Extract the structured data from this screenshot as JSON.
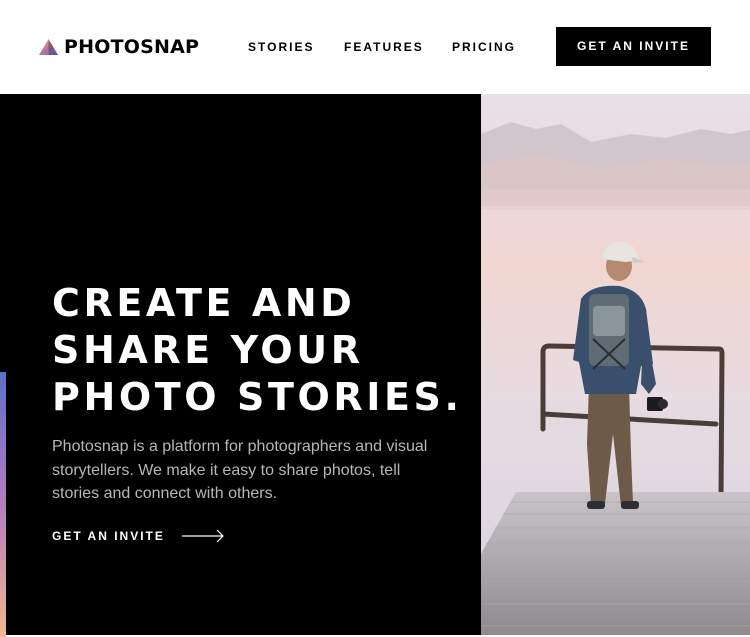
{
  "header": {
    "logo_text": "PHOTOSNAP",
    "nav": [
      {
        "label": "STORIES"
      },
      {
        "label": "FEATURES"
      },
      {
        "label": "PRICING"
      }
    ],
    "cta_label": "GET AN INVITE"
  },
  "hero": {
    "headline_lines": [
      "CREATE AND",
      "SHARE YOUR",
      "PHOTO STORIES."
    ],
    "body": "Photosnap is a platform for photographers and visual storytellers. We make it easy to share photos, tell stories and connect with others.",
    "cta_label": "GET AN INVITE",
    "cta_icon": "arrow-right-icon",
    "photo_subject": "man-with-backpack-on-pier-photo"
  },
  "colors": {
    "hero_background": "#000000",
    "header_background": "#ffffff",
    "accent_gradient": [
      "#5c6fc9",
      "#b77cc0",
      "#f2b88e"
    ]
  }
}
